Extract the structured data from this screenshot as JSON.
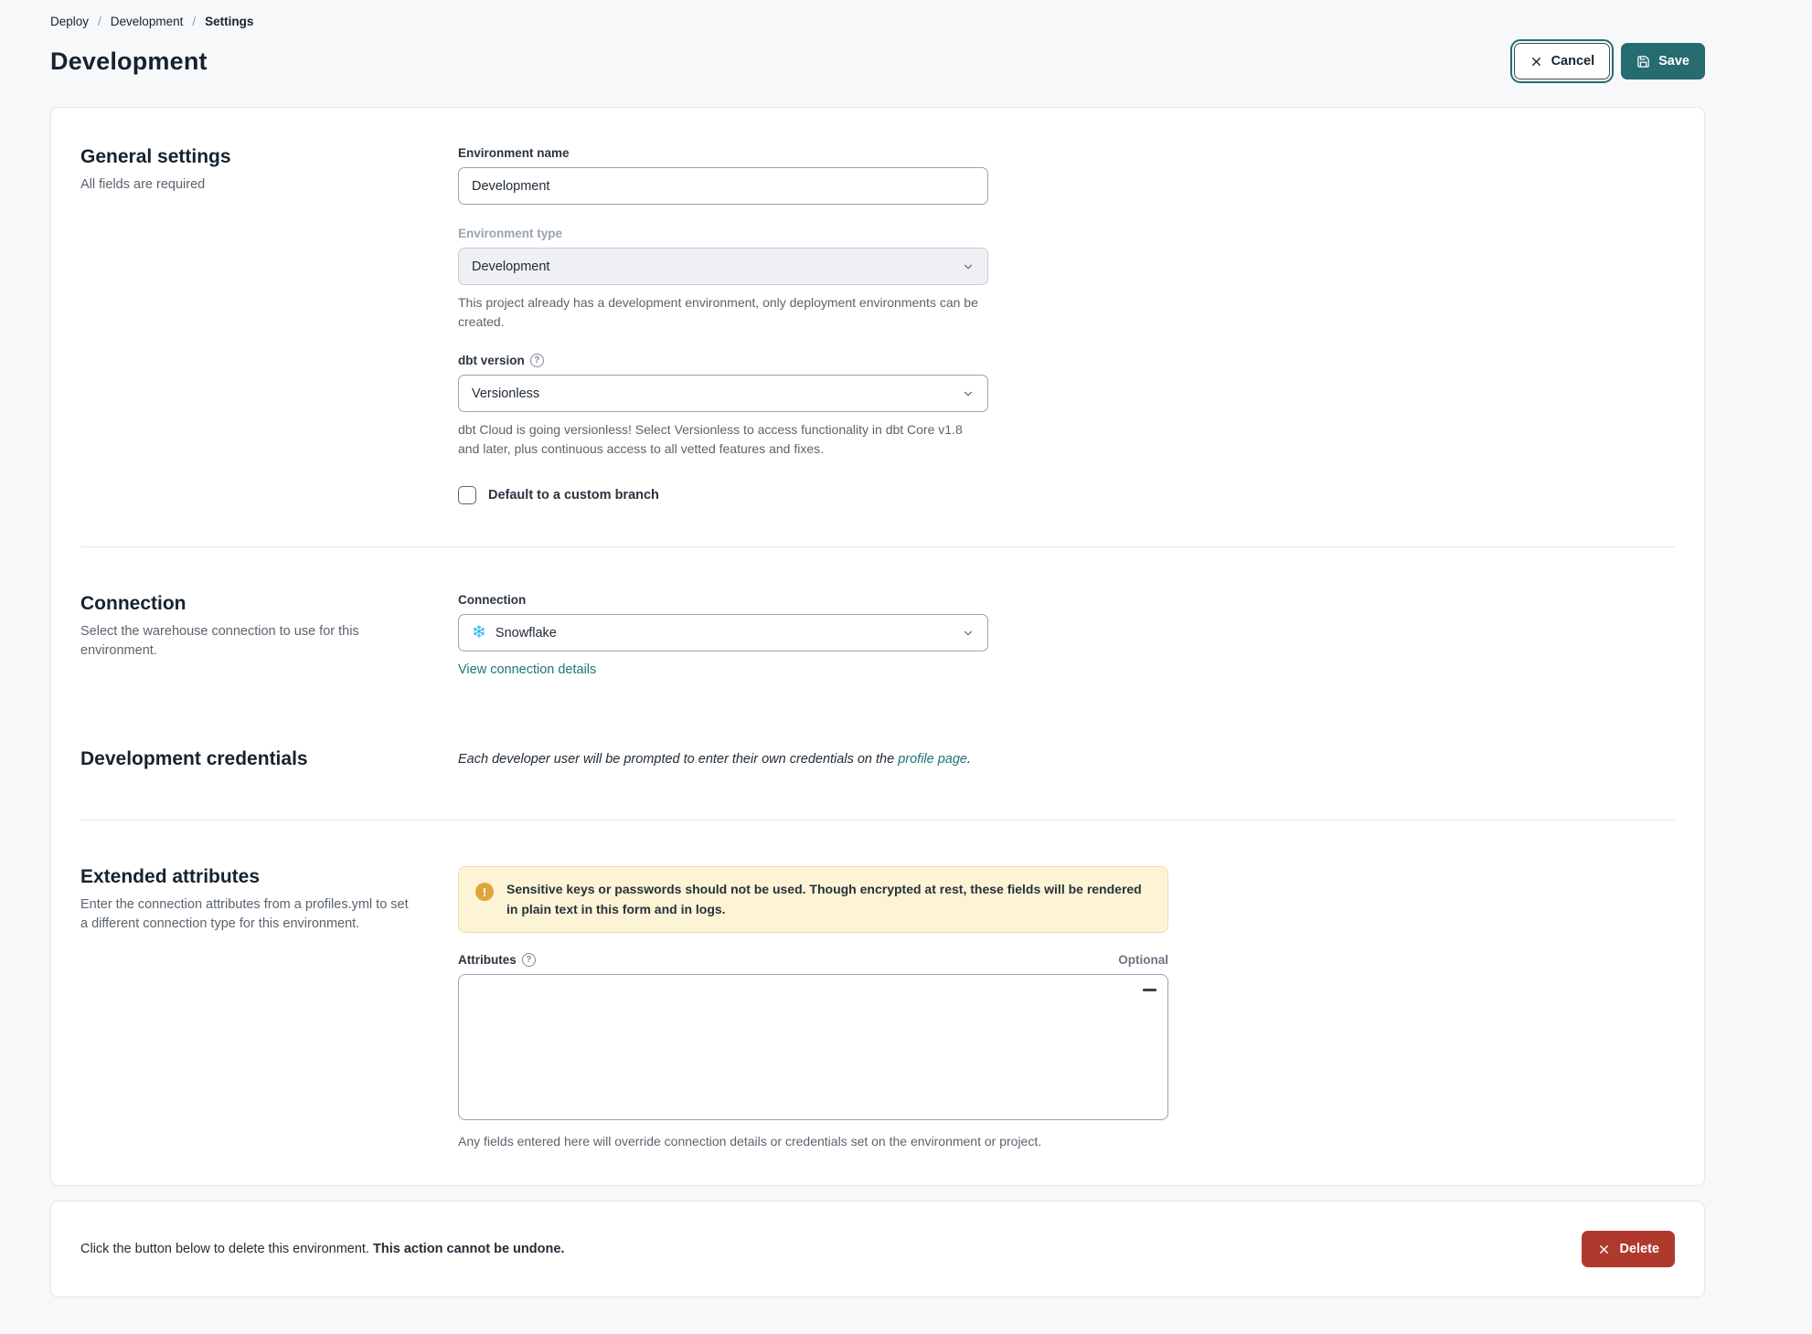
{
  "breadcrumb": {
    "items": [
      "Deploy",
      "Development",
      "Settings"
    ],
    "separator": "/"
  },
  "page": {
    "title": "Development"
  },
  "actions": {
    "cancel_label": "Cancel",
    "save_label": "Save",
    "delete_label": "Delete"
  },
  "general": {
    "heading": "General settings",
    "description": "All fields are required",
    "env_name_label": "Environment name",
    "env_name_value": "Development",
    "env_type_label": "Environment type",
    "env_type_value": "Development",
    "env_type_help": "This project already has a development environment, only deployment environments can be created.",
    "dbt_version_label": "dbt version",
    "dbt_version_value": "Versionless",
    "dbt_version_help": "dbt Cloud is going versionless! Select Versionless to access functionality in dbt Core v1.8 and later, plus continuous access to all vetted features and fixes.",
    "custom_branch_label": "Default to a custom branch",
    "custom_branch_checked": false
  },
  "connection": {
    "heading": "Connection",
    "description": "Select the warehouse connection to use for this environment.",
    "label": "Connection",
    "value": "Snowflake",
    "details_link": "View connection details"
  },
  "credentials": {
    "heading": "Development credentials",
    "text_before": "Each developer user will be prompted to enter their own credentials on the ",
    "link_text": "profile page",
    "text_after": "."
  },
  "extended": {
    "heading": "Extended attributes",
    "description": "Enter the connection attributes from a profiles.yml to set a different connection type for this environment.",
    "warning_text": "Sensitive keys or passwords should not be used. Though encrypted at rest, these fields will be rendered in plain text in this form and in logs.",
    "attributes_label": "Attributes",
    "optional_label": "Optional",
    "attributes_value": "",
    "footer": "Any fields entered here will override connection details or credentials set on the environment or project."
  },
  "danger": {
    "text": "Click the button below to delete this environment. ",
    "text_bold": "This action cannot be undone."
  },
  "icons": {
    "help_glyph": "?",
    "warning_glyph": "!",
    "snowflake_glyph": "❄"
  },
  "colors": {
    "teal": "#266b70",
    "teal_link": "#1e7478",
    "delete_red": "#b0392e",
    "snowflake_blue": "#29b5e8",
    "warning_bg": "#fcf4d5",
    "warning_icon": "#e0a53c",
    "page_bg": "#f7f8fa"
  }
}
